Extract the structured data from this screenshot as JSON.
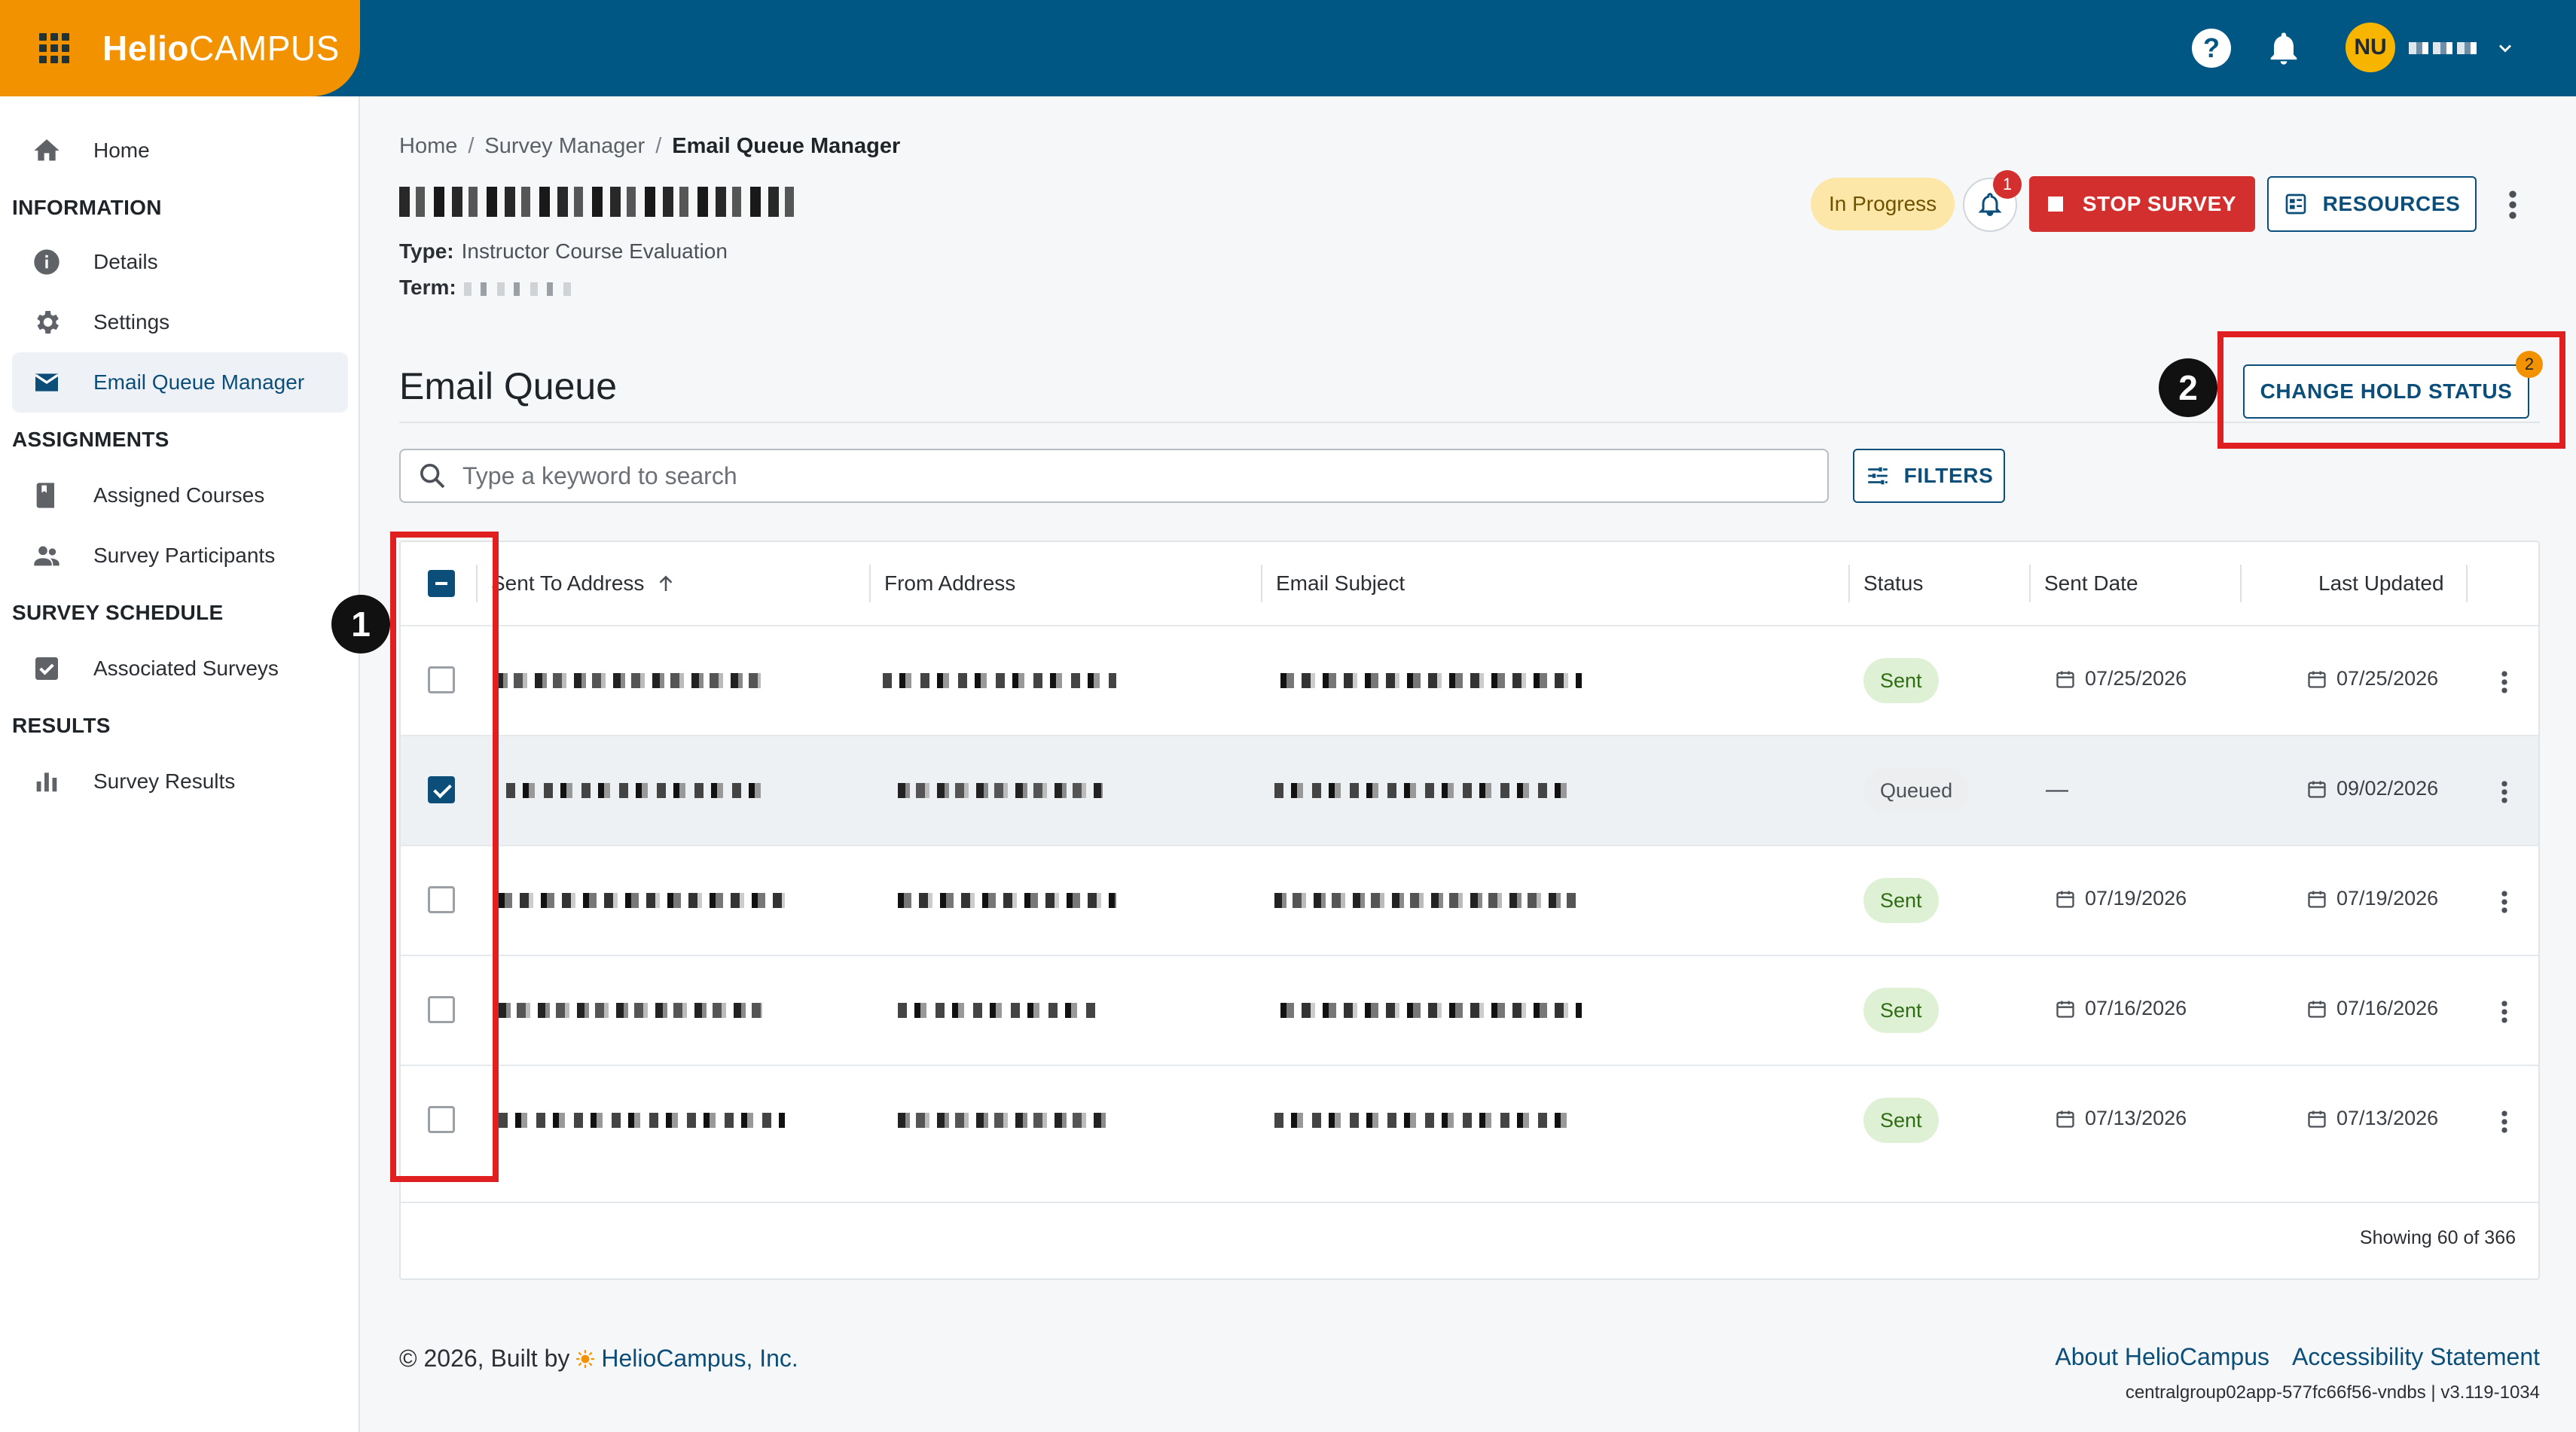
{
  "app": {
    "logo_main": "Helio",
    "logo_sub": "CAMPUS",
    "user_initials": "NU"
  },
  "colors": {
    "topbar": "#005784",
    "brand_orange": "#f39200",
    "primary": "#0b4e7a",
    "danger": "#d32f2f",
    "annotation_red": "#e02020"
  },
  "sidebar": {
    "home": "Home",
    "sections": [
      {
        "heading": "INFORMATION",
        "items": [
          "Details",
          "Settings",
          "Email Queue Manager"
        ]
      },
      {
        "heading": "ASSIGNMENTS",
        "items": [
          "Assigned Courses",
          "Survey Participants"
        ]
      },
      {
        "heading": "SURVEY SCHEDULE",
        "items": [
          "Associated Surveys"
        ]
      },
      {
        "heading": "RESULTS",
        "items": [
          "Survey Results"
        ]
      }
    ],
    "active_item": "Email Queue Manager"
  },
  "breadcrumb": [
    "Home",
    "Survey Manager",
    "Email Queue Manager"
  ],
  "survey": {
    "type_label": "Type:",
    "type_value": "Instructor Course Evaluation",
    "term_label": "Term:",
    "status_pill": "In Progress",
    "notification_count": "1",
    "stop_label": "STOP SURVEY",
    "resources_label": "RESOURCES"
  },
  "queue": {
    "title": "Email Queue",
    "change_hold_label": "CHANGE HOLD STATUS",
    "change_hold_count": "2",
    "search_placeholder": "Type a keyword to search",
    "filters_label": "FILTERS",
    "annotations": [
      "1",
      "2"
    ]
  },
  "table": {
    "columns": [
      "Sent To Address",
      "From Address",
      "Email Subject",
      "Status",
      "Sent Date",
      "Last Updated"
    ],
    "rows": [
      {
        "status": "Sent",
        "sent_date": "07/25/2026",
        "updated": "07/25/2026",
        "checked": false
      },
      {
        "status": "Queued",
        "sent_date": "—",
        "updated": "09/02/2026",
        "checked": true
      },
      {
        "status": "Sent",
        "sent_date": "07/19/2026",
        "updated": "07/19/2026",
        "checked": false
      },
      {
        "status": "Sent",
        "sent_date": "07/16/2026",
        "updated": "07/16/2026",
        "checked": false
      },
      {
        "status": "Sent",
        "sent_date": "07/13/2026",
        "updated": "07/13/2026",
        "checked": false
      }
    ],
    "showing": "Showing 60 of 366"
  },
  "footer": {
    "copyright": "© 2026, Built by",
    "company": "HelioCampus, Inc.",
    "about": "About HelioCampus",
    "accessibility": "Accessibility Statement",
    "build": "centralgroup02app-577fc66f56-vndbs | v3.119-1034"
  }
}
